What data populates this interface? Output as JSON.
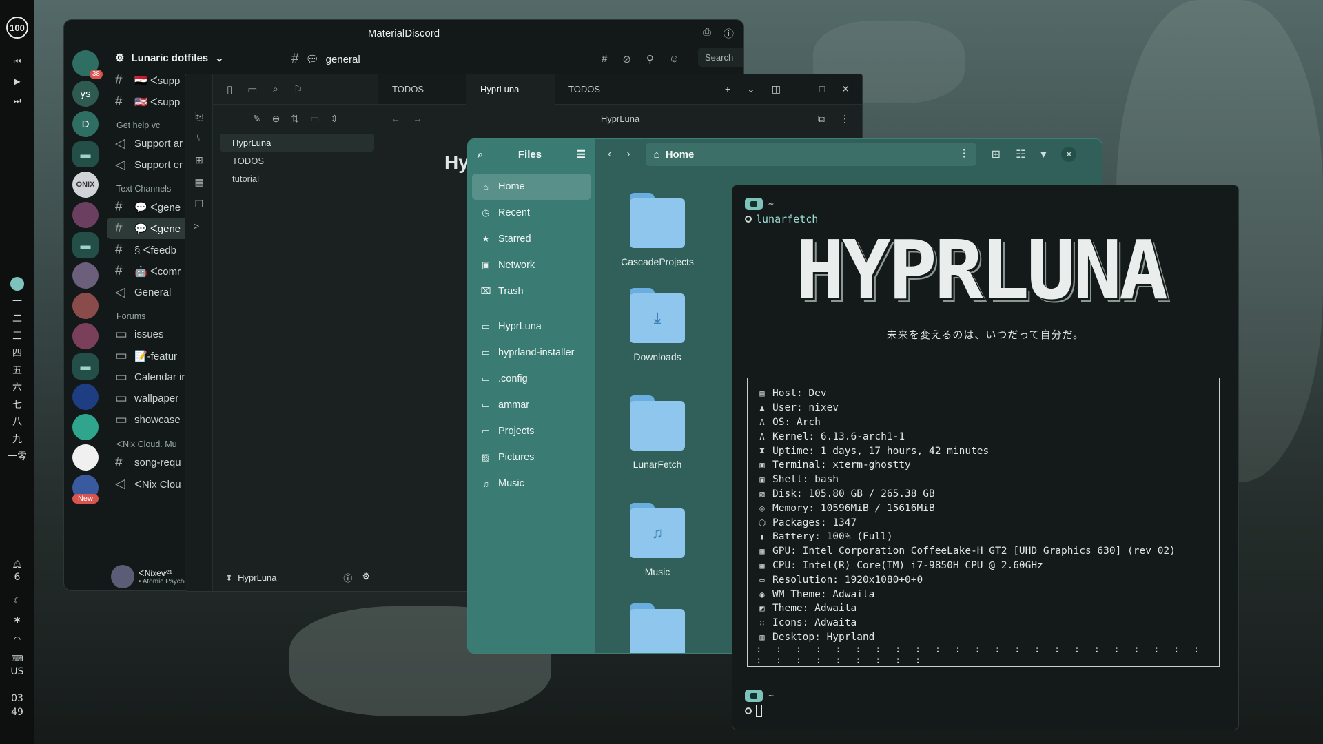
{
  "bar": {
    "clock_ring": "100",
    "workspaces": [
      "一",
      "二",
      "三",
      "四",
      "五",
      "六",
      "七",
      "八",
      "九",
      "一零"
    ],
    "notif_count": "6",
    "kb_layout": "US",
    "time_hour": "03",
    "time_min": "49"
  },
  "discord": {
    "title": "MaterialDiscord",
    "server_name": "Lunaric dotfiles",
    "topic": "general",
    "search_placeholder": "Search",
    "servers": [
      {
        "label": "",
        "badge": "38"
      },
      {
        "label": "ys"
      },
      {
        "label": "D"
      },
      {
        "label": "ONIX"
      },
      {
        "label": ""
      }
    ],
    "cat_help": "Get help vc",
    "cat_text": "Text Channels",
    "cat_forums": "Forums",
    "channels_top": [
      "🇪🇬 ᐸsupp",
      "🇺🇸 ᐸsupp"
    ],
    "voice": [
      "Support ar",
      "Support er"
    ],
    "text": [
      "💬 ᐸgene",
      "💬 ᐸgene",
      "§ ᐸfeedb",
      "🤖 ᐸcomr"
    ],
    "general_voice": "General",
    "forums": [
      "issues",
      "📝-featur",
      "Calendar ir",
      "wallpaper",
      "showcase"
    ],
    "nix_cat": "ᐸNix Cloud. Mu",
    "song": "song-requ",
    "nix_voice": "ᐸNix Clou",
    "new_badge": "New",
    "user_name": "ᐸNixev⁄²¹",
    "user_status": "• Atomic Psycho"
  },
  "obsidian": {
    "tree": [
      "HyprLuna",
      "TODOS",
      "tutorial"
    ],
    "vault": "HyprLuna",
    "tabs": [
      "TODOS",
      "HyprLuna",
      "TODOS"
    ],
    "note_title": "HyprLuna",
    "heading": "Hy"
  },
  "files": {
    "title": "Files",
    "path": "Home",
    "places": [
      {
        "icon": "home-icon",
        "label": "Home",
        "glyph": "⌂"
      },
      {
        "icon": "recent-icon",
        "label": "Recent",
        "glyph": "◷"
      },
      {
        "icon": "star-icon",
        "label": "Starred",
        "glyph": "★"
      },
      {
        "icon": "network-icon",
        "label": "Network",
        "glyph": "▣"
      },
      {
        "icon": "trash-icon",
        "label": "Trash",
        "glyph": "⌧"
      }
    ],
    "bookmarks": [
      {
        "label": "HyprLuna",
        "glyph": "▭"
      },
      {
        "label": "hyprland-installer",
        "glyph": "▭"
      },
      {
        "label": ".config",
        "glyph": "▭"
      },
      {
        "label": "ammar",
        "glyph": "▭"
      },
      {
        "label": "Projects",
        "glyph": "▭"
      },
      {
        "label": "Pictures",
        "glyph": "▨"
      },
      {
        "label": "Music",
        "glyph": "♫"
      }
    ],
    "items": [
      {
        "label": "CascadeProjects",
        "glyph": ""
      },
      {
        "label": "Downloads",
        "glyph": "⤓"
      },
      {
        "label": "LunarFetch",
        "glyph": ""
      },
      {
        "label": "Music",
        "glyph": "♫"
      },
      {
        "label": "",
        "glyph": ""
      }
    ]
  },
  "terminal": {
    "prompt_dir": "~",
    "command": "lunarfetch",
    "logo": "HYPRLUNA",
    "motto": "未来を変えるのは、いつだって自分だ。",
    "info": [
      {
        "g": "▤",
        "t": "Host: Dev"
      },
      {
        "g": "▲",
        "t": "User: nixev"
      },
      {
        "g": "Λ",
        "t": "OS: Arch"
      },
      {
        "g": "Λ",
        "t": "Kernel: 6.13.6-arch1-1"
      },
      {
        "g": "⧗",
        "t": "Uptime: 1 days, 17 hours, 42 minutes"
      },
      {
        "g": "▣",
        "t": "Terminal: xterm-ghostty"
      },
      {
        "g": "▣",
        "t": "Shell: bash"
      },
      {
        "g": "▨",
        "t": "Disk: 105.80 GB / 265.38 GB"
      },
      {
        "g": "◎",
        "t": "Memory: 10596MiB / 15616MiB"
      },
      {
        "g": "⬡",
        "t": "Packages: 1347"
      },
      {
        "g": "▮",
        "t": "Battery: 100% (Full)"
      },
      {
        "g": "▦",
        "t": "GPU: Intel Corporation CoffeeLake-H GT2 [UHD Graphics 630] (rev 02)"
      },
      {
        "g": "▦",
        "t": "CPU: Intel(R) Core(TM) i7-9850H CPU @ 2.60GHz"
      },
      {
        "g": "▭",
        "t": "Resolution: 1920x1080+0+0"
      },
      {
        "g": "◉",
        "t": "WM Theme: Adwaita"
      },
      {
        "g": "◩",
        "t": "Theme: Adwaita"
      },
      {
        "g": "∷",
        "t": "Icons: Adwaita"
      },
      {
        "g": "▥",
        "t": "Desktop: Hyprland"
      }
    ],
    "dots": ": : : : : : : : : : : : : : : : : : : : : : : : : : : : : : : :"
  }
}
